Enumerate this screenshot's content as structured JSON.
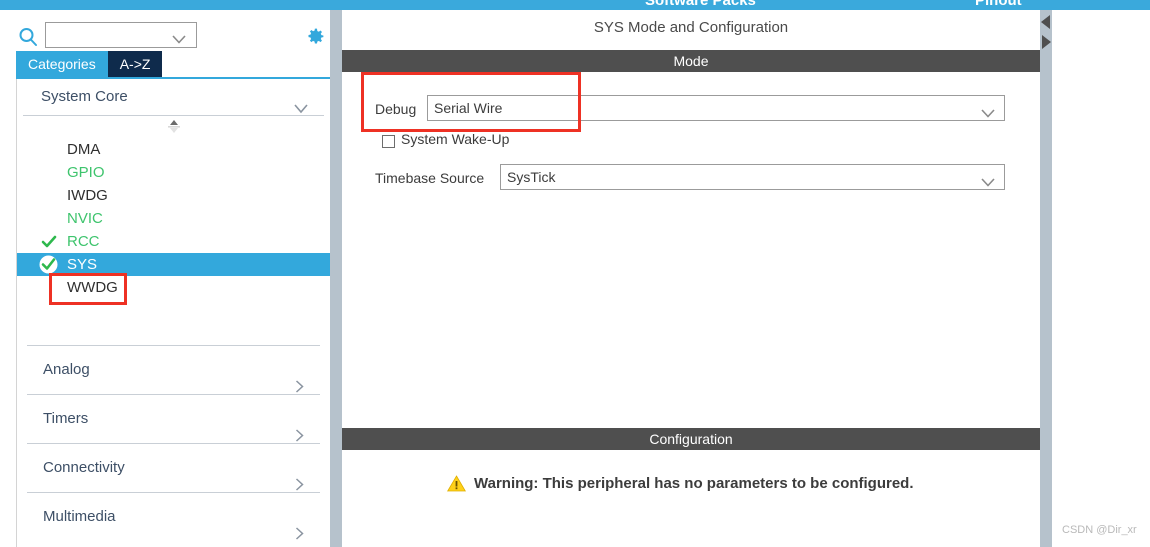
{
  "topbar": {
    "software_packs_label": "Software Packs",
    "pinout_label": "Pinout",
    "background_color": "#3aa9dc"
  },
  "sidebar": {
    "search": {
      "value": "",
      "placeholder": "",
      "icon": "search-icon",
      "caret_icon": "chevron-down-icon"
    },
    "settings_icon": "gear-icon",
    "tabs": [
      {
        "label": "Categories",
        "active": true
      },
      {
        "label": "A->Z",
        "active": false
      }
    ],
    "expanded_group": {
      "label": "System Core",
      "chevron_icon": "chevron-down-icon",
      "items": [
        {
          "label": "DMA",
          "state": "normal",
          "check": "none"
        },
        {
          "label": "GPIO",
          "state": "available",
          "check": "none"
        },
        {
          "label": "IWDG",
          "state": "normal",
          "check": "none"
        },
        {
          "label": "NVIC",
          "state": "available",
          "check": "none"
        },
        {
          "label": "RCC",
          "state": "available",
          "check": "green-check-icon"
        },
        {
          "label": "SYS",
          "state": "selected",
          "check": "green-check-badge-icon"
        },
        {
          "label": "WWDG",
          "state": "normal",
          "check": "none"
        }
      ]
    },
    "collapsed_groups": [
      {
        "label": "Analog",
        "chevron_icon": "chevron-right-icon"
      },
      {
        "label": "Timers",
        "chevron_icon": "chevron-right-icon"
      },
      {
        "label": "Connectivity",
        "chevron_icon": "chevron-right-icon"
      },
      {
        "label": "Multimedia",
        "chevron_icon": "chevron-right-icon"
      }
    ],
    "selected_color": "#33a8dc",
    "available_color": "#3ec46d",
    "tab_active_color": "#33a8dc",
    "tab_inactive_color": "#0f2b4c"
  },
  "main": {
    "title": "SYS Mode and Configuration",
    "mode_section": {
      "header": "Mode",
      "debug": {
        "label": "Debug",
        "value": "Serial Wire",
        "caret_icon": "chevron-down-icon"
      },
      "system_wake_up": {
        "label": "System Wake-Up",
        "checked": false
      },
      "timebase_source": {
        "label": "Timebase Source",
        "value": "SysTick",
        "caret_icon": "chevron-down-icon"
      }
    },
    "config_section": {
      "header": "Configuration",
      "warning_icon": "warning-triangle-icon",
      "warning_text": "Warning: This peripheral has no parameters to be configured."
    },
    "header_color": "#4f4f4f"
  },
  "annotations": [
    {
      "name": "debug-highlight",
      "color": "#ee3124"
    },
    {
      "name": "sys-highlight",
      "color": "#ee3124"
    }
  ],
  "right_strip": {
    "collapse_handle_icon": "triangle-left-icon",
    "expand_handle_icon": "triangle-right-icon"
  },
  "watermark": "CSDN @Dir_xr"
}
